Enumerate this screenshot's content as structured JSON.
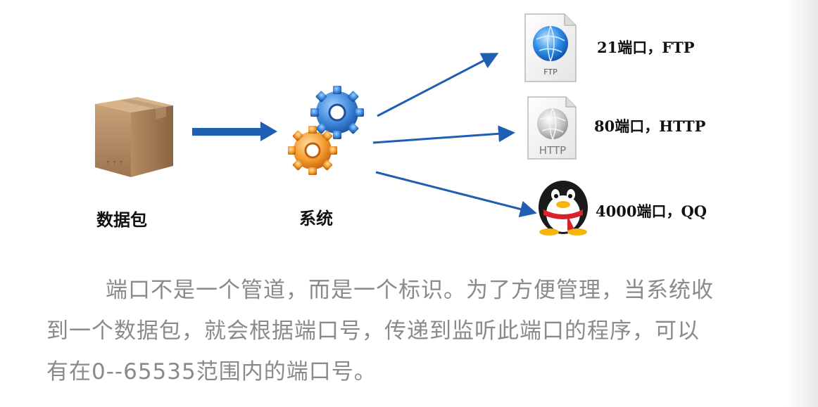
{
  "diagram": {
    "nodes": {
      "packet": "数据包",
      "system": "系统"
    },
    "ports": [
      {
        "label": "21端口，FTP",
        "icon": "ftp-file-icon",
        "icon_text": "FTP"
      },
      {
        "label": "80端口，HTTP",
        "icon": "http-file-icon",
        "icon_text": "HTTP"
      },
      {
        "label": "4000端口，QQ",
        "icon": "qq-penguin-icon"
      }
    ],
    "colors": {
      "arrow": "#1f5fb3",
      "text": "#111111",
      "paragraph": "#8a8a8a"
    }
  },
  "paragraph": {
    "lines": [
      "端口不是一个管道，而是一个标识。为了方便管理，当系统收",
      "到一个数据包，就会根据端口号，传递到监听此端口的程序，可以",
      "有在0--65535范围内的端口号。"
    ]
  }
}
